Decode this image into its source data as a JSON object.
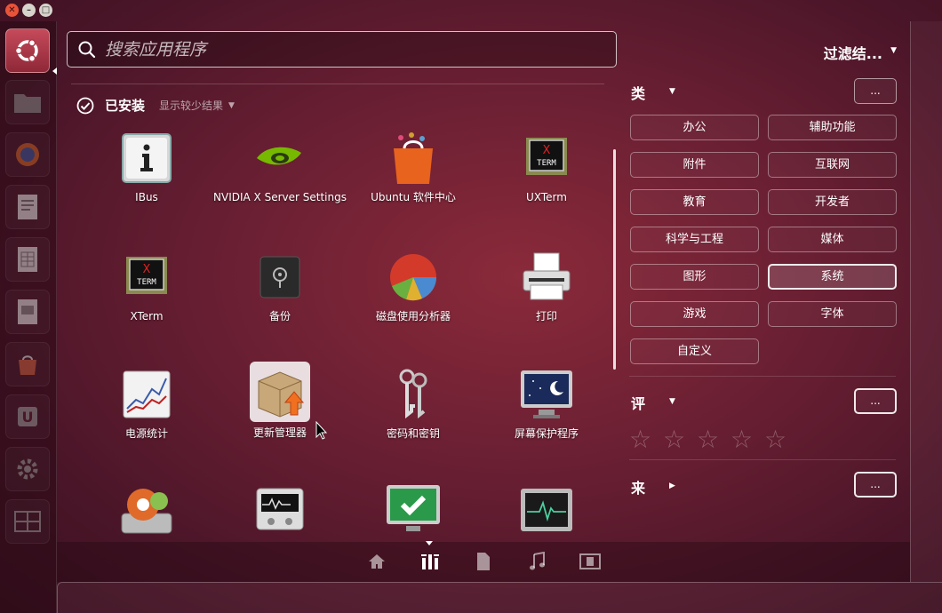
{
  "search": {
    "placeholder": "搜索应用程序"
  },
  "filters": {
    "title": "过滤结..."
  },
  "installed": {
    "title": "已安装",
    "toggle": "显示较少结果"
  },
  "apps": [
    {
      "label": "IBus"
    },
    {
      "label": "NVIDIA X Server Settings"
    },
    {
      "label": "Ubuntu 软件中心"
    },
    {
      "label": "UXTerm"
    },
    {
      "label": "XTerm"
    },
    {
      "label": "备份"
    },
    {
      "label": "磁盘使用分析器"
    },
    {
      "label": "打印"
    },
    {
      "label": "电源统计"
    },
    {
      "label": "更新管理器"
    },
    {
      "label": "密码和密钥"
    },
    {
      "label": "屏幕保护程序"
    }
  ],
  "sections": {
    "category": {
      "label": "类",
      "more": "..."
    },
    "rating": {
      "label": "评",
      "more": "..."
    },
    "source": {
      "label": "来",
      "more": "..."
    }
  },
  "categories": [
    "办公",
    "辅助功能",
    "附件",
    "互联网",
    "教育",
    "开发者",
    "科学与工程",
    "媒体",
    "图形",
    "系统",
    "游戏",
    "字体",
    "自定义"
  ],
  "active_category": "系统",
  "rating_stars": 5,
  "lenses": [
    "home-lens",
    "applications-lens",
    "files-lens",
    "music-lens",
    "video-lens"
  ],
  "active_lens": "applications-lens",
  "colors": {
    "accent": "#c64a5a",
    "background": "#6a1f33"
  }
}
